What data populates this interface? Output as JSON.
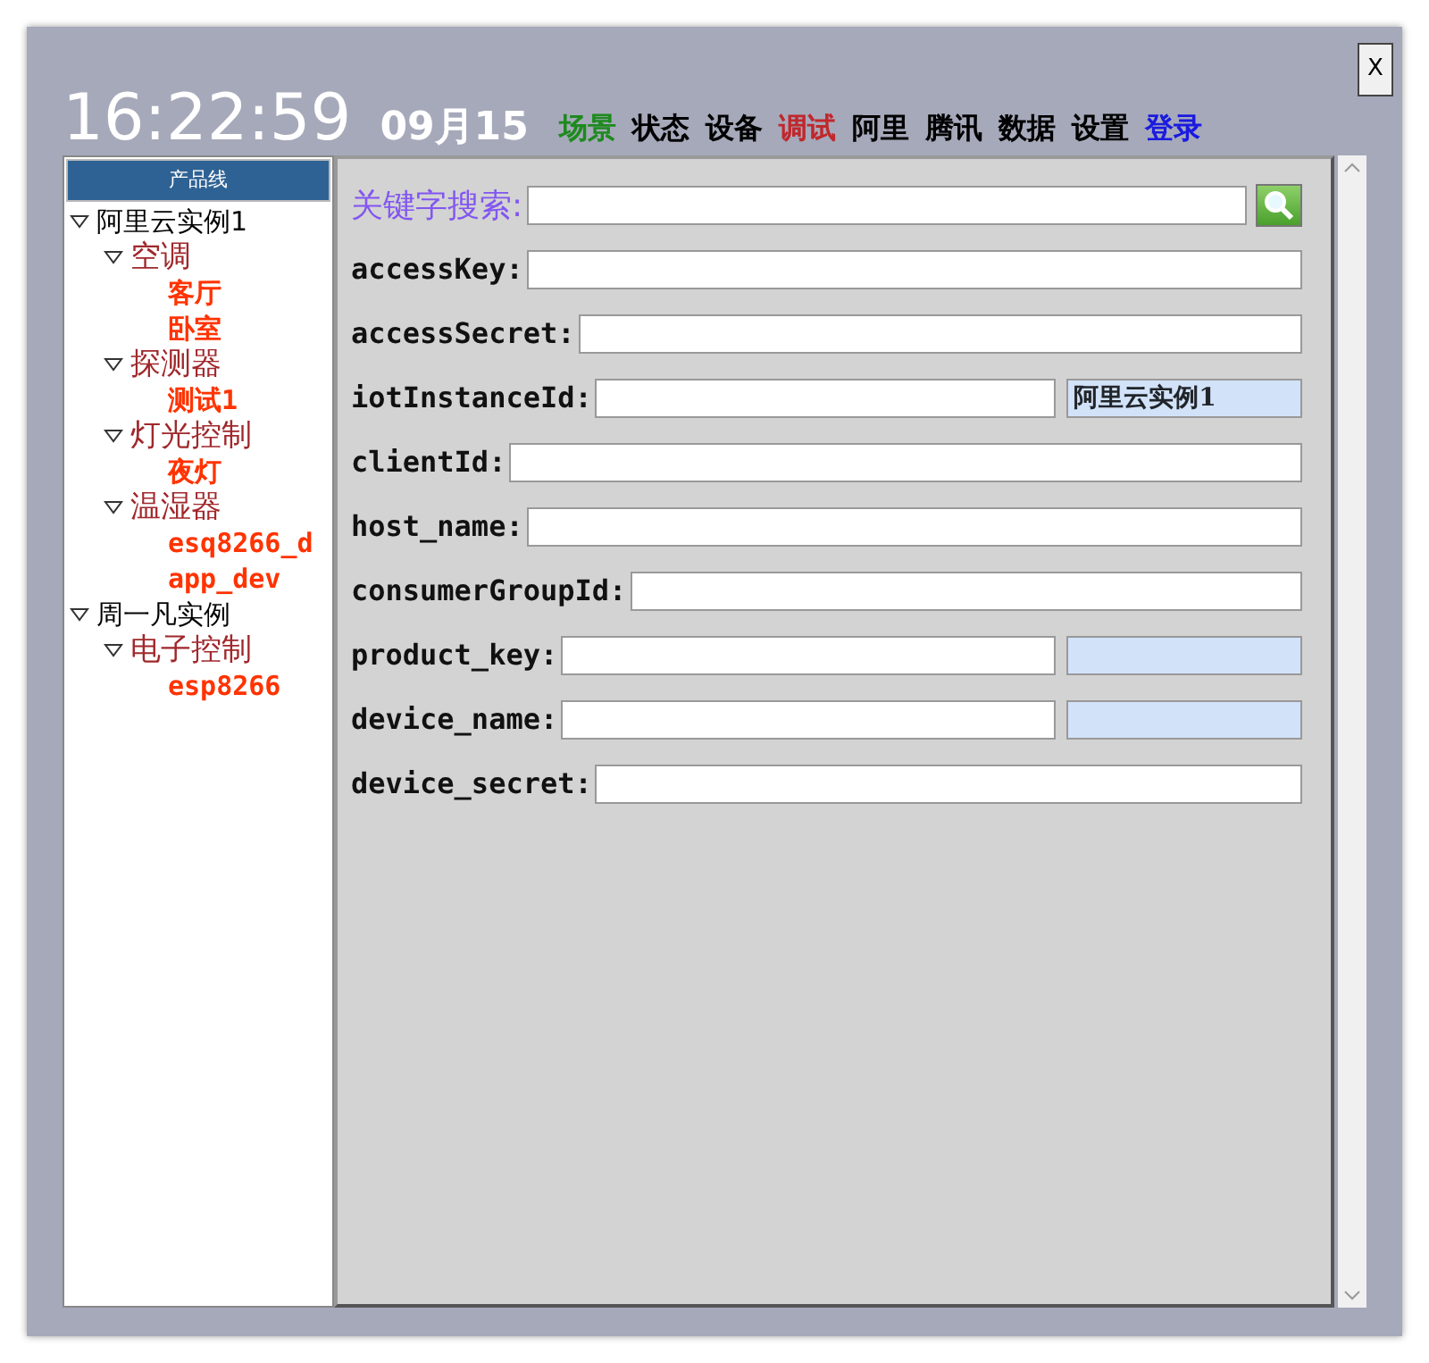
{
  "clock": {
    "time": "16:22:59",
    "date": "09月15"
  },
  "nav": [
    {
      "label": "场景",
      "color": "#1e8a1e"
    },
    {
      "label": "状态",
      "color": "#000000"
    },
    {
      "label": "设备",
      "color": "#000000"
    },
    {
      "label": "调试",
      "color": "#c0282c"
    },
    {
      "label": "阿里",
      "color": "#000000"
    },
    {
      "label": "腾讯",
      "color": "#000000"
    },
    {
      "label": "数据",
      "color": "#000000"
    },
    {
      "label": "设置",
      "color": "#000000"
    },
    {
      "label": "登录",
      "color": "#1a1ae0"
    }
  ],
  "close_button": "X",
  "tree": {
    "header": "产品线",
    "items": [
      {
        "label": "阿里云实例1",
        "expanded": true,
        "children": [
          {
            "label": "空调",
            "expanded": true,
            "children": [
              {
                "label": "客厅"
              },
              {
                "label": "卧室"
              }
            ]
          },
          {
            "label": "探测器",
            "expanded": true,
            "children": [
              {
                "label": "测试1"
              }
            ]
          },
          {
            "label": "灯光控制",
            "expanded": true,
            "children": [
              {
                "label": "夜灯"
              }
            ]
          },
          {
            "label": "温湿器",
            "expanded": true,
            "children": [
              {
                "label": "esq8266_d"
              },
              {
                "label": "app_dev"
              }
            ]
          }
        ]
      },
      {
        "label": "周一凡实例",
        "expanded": true,
        "children": [
          {
            "label": "电子控制",
            "expanded": true,
            "children": [
              {
                "label": "esp8266"
              }
            ]
          }
        ]
      }
    ]
  },
  "search": {
    "label": "关键字搜索:"
  },
  "fields": [
    {
      "label": "accessKey:"
    },
    {
      "label": "accessSecret:"
    },
    {
      "label": "iotInstanceId:",
      "kind": "pair",
      "value": "阿里云实例1"
    },
    {
      "label": "clientId:"
    },
    {
      "label": "host_name:"
    },
    {
      "label": "consumerGroupId:"
    },
    {
      "label": "product_key:",
      "kind": "pair"
    },
    {
      "label": "device_name:",
      "kind": "pair"
    },
    {
      "label": "device_secret:"
    }
  ]
}
